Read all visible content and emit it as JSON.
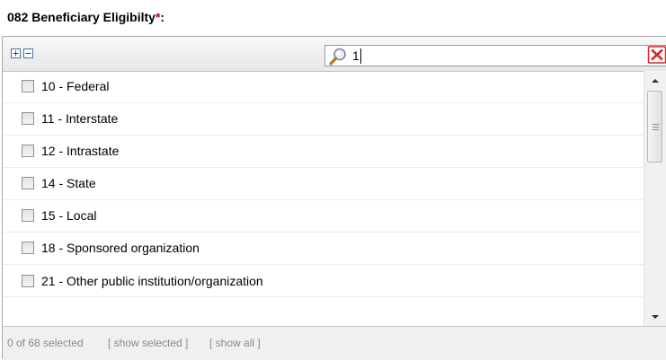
{
  "field": {
    "label": "082 Beneficiary Eligibilty",
    "required_mark": "*",
    "suffix": ":"
  },
  "toolbar": {
    "expand_icon": "expand-all-icon",
    "collapse_icon": "collapse-all-icon",
    "search_value": "1",
    "search_icon": "magnifier-icon",
    "clear_icon": "clear-red-x-icon"
  },
  "items": [
    {
      "label": "10 - Federal",
      "checked": false
    },
    {
      "label": "11 - Interstate",
      "checked": false
    },
    {
      "label": "12 - Intrastate",
      "checked": false
    },
    {
      "label": "14 - State",
      "checked": false
    },
    {
      "label": "15 - Local",
      "checked": false
    },
    {
      "label": "18 - Sponsored organization",
      "checked": false
    },
    {
      "label": "21 - Other public institution/organization",
      "checked": false
    }
  ],
  "footer": {
    "count": "0 of 68 selected",
    "show_selected": "[ show selected ]",
    "show_all": "[ show all ]"
  },
  "colors": {
    "required": "#cc0000",
    "clear_icon": "#d9272e",
    "icon_border": "#4a6fa5"
  }
}
